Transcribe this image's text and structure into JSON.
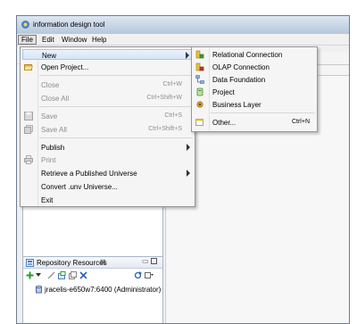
{
  "window": {
    "title": "information design tool"
  },
  "menubar": {
    "items": [
      "File",
      "Edit",
      "Window",
      "Help"
    ]
  },
  "file_menu": {
    "new": "New",
    "open_project": "Open Project...",
    "close": "Close",
    "close_sc": "Ctrl+W",
    "close_all": "Close All",
    "close_all_sc": "Ctrl+Shift+W",
    "save": "Save",
    "save_sc": "Ctrl+S",
    "save_all": "Save All",
    "save_all_sc": "Ctrl+Shift+S",
    "publish": "Publish",
    "print": "Print",
    "retrieve": "Retrieve a Published Universe",
    "convert": "Convert .unv Universe...",
    "exit": "Exit"
  },
  "new_submenu": {
    "relational": "Relational Connection",
    "olap": "OLAP Connection",
    "data_foundation": "Data Foundation",
    "project": "Project",
    "business_layer": "Business Layer",
    "other": "Other...",
    "other_sc": "Ctrl+N"
  },
  "repository": {
    "title": "Repository Resources",
    "close_glyph": "⊠",
    "minimize_glyph": "▭",
    "session": "jracelis-e650w7:6400 (Administrator)"
  },
  "colors": {
    "highlight": "#d6e5f7",
    "titlebar": "#c6d5e6",
    "disabled_text": "#8d8d8d"
  }
}
